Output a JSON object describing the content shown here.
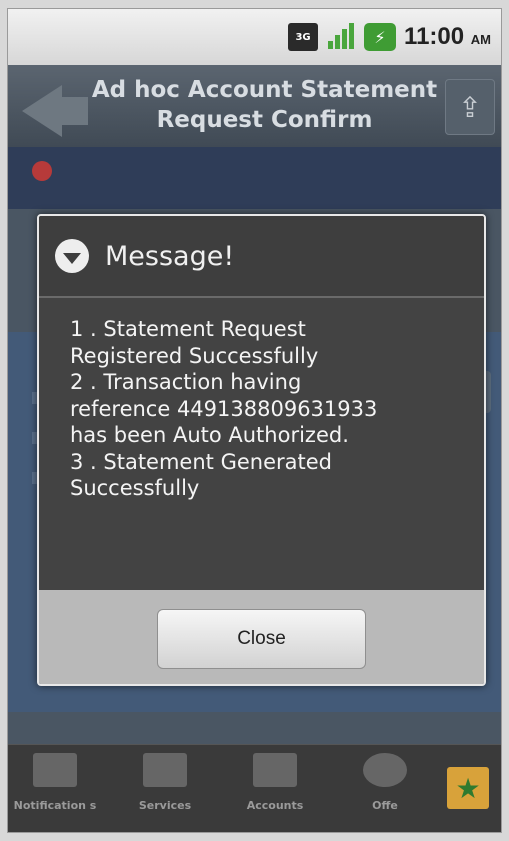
{
  "status_bar": {
    "network_label": "3G",
    "time": "11:00",
    "ampm": "AM"
  },
  "header": {
    "title": "Ad hoc Account Statement Request Confirm"
  },
  "dialog": {
    "title": "Message!",
    "message_lines": [
      "1 . Statement Request",
      "Registered Successfully",
      "2 . Transaction having",
      "reference 449138809631933",
      "has been Auto Authorized.",
      "3 . Statement Generated",
      "Successfully"
    ],
    "close_label": "Close"
  },
  "bottom_nav": {
    "items": [
      {
        "label": "Notification s",
        "icon": "notification-icon"
      },
      {
        "label": "Services",
        "icon": "wallet-icon"
      },
      {
        "label": "Accounts",
        "icon": "card-icon"
      },
      {
        "label": "Offe",
        "icon": "offers-badge-icon"
      }
    ]
  },
  "colors": {
    "title_bar": "#4a5560",
    "dialog_body": "#434343",
    "dialog_footer": "#b9b9b9",
    "fav_button": "#d8a23a"
  }
}
